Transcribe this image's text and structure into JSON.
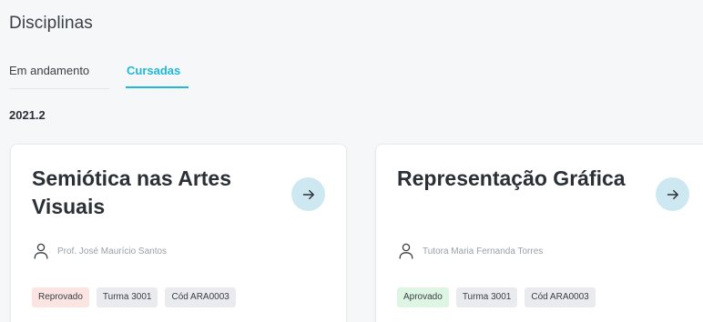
{
  "page": {
    "title": "Disciplinas"
  },
  "tabs": [
    {
      "label": "Em andamento",
      "active": false
    },
    {
      "label": "Cursadas",
      "active": true
    }
  ],
  "semester": "2021.2",
  "colors": {
    "accent": "#1fb8d9",
    "status_reprovado_bg": "#fbe4e1",
    "status_aprovado_bg": "#def5e4",
    "arrow_button_bg": "#cde8f1"
  },
  "courses": [
    {
      "title": "Semiótica nas Artes Visuais",
      "teacher": "Prof. José Maurício Santos",
      "teacher_icon": "person-icon",
      "status": "Reprovado",
      "class": "Turma 3001",
      "code": "Cód ARA0003",
      "action_icon": "arrow-right-icon"
    },
    {
      "title": "Representação Gráfica",
      "teacher": "Tutora Maria Fernanda Torres",
      "teacher_icon": "person-icon",
      "status": "Aprovado",
      "class": "Turma 3001",
      "code": "Cód ARA0003",
      "action_icon": "arrow-right-icon"
    }
  ]
}
